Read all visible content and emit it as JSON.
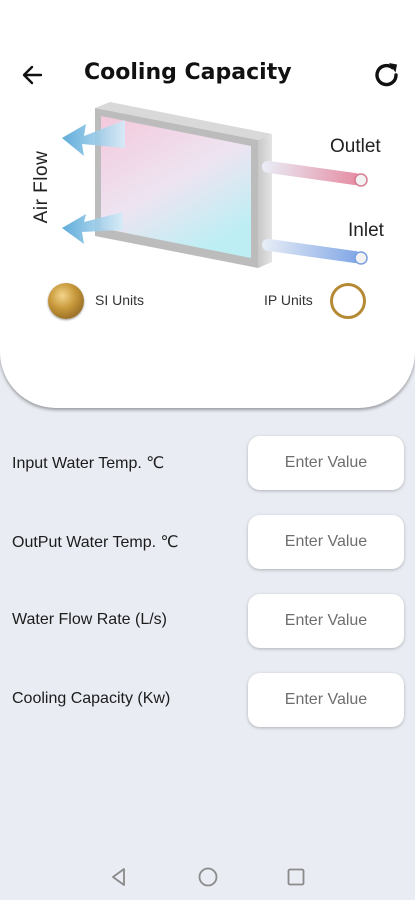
{
  "header": {
    "title": "Cooling Capacity",
    "back_icon": "arrow-left-icon",
    "refresh_icon": "refresh-icon"
  },
  "diagram": {
    "airflow_label": "Air Flow",
    "outlet_label": "Outlet",
    "inlet_label": "Inlet"
  },
  "units": {
    "si_label": "SI Units",
    "ip_label": "IP Units",
    "selected": "SI Units",
    "accent_color": "#c99a3c"
  },
  "fields": [
    {
      "label": "Input Water Temp. ℃",
      "placeholder": "Enter Value",
      "value": ""
    },
    {
      "label": "OutPut Water Temp. ℃",
      "placeholder": "Enter Value",
      "value": ""
    },
    {
      "label": "Water Flow Rate (L/s)",
      "placeholder": "Enter Value",
      "value": ""
    },
    {
      "label": "Cooling Capacity (Kw)",
      "placeholder": "Enter Value",
      "value": ""
    }
  ],
  "navigation": {
    "back_icon": "triangle-back-icon",
    "home_icon": "circle-home-icon",
    "recents_icon": "square-recents-icon"
  }
}
